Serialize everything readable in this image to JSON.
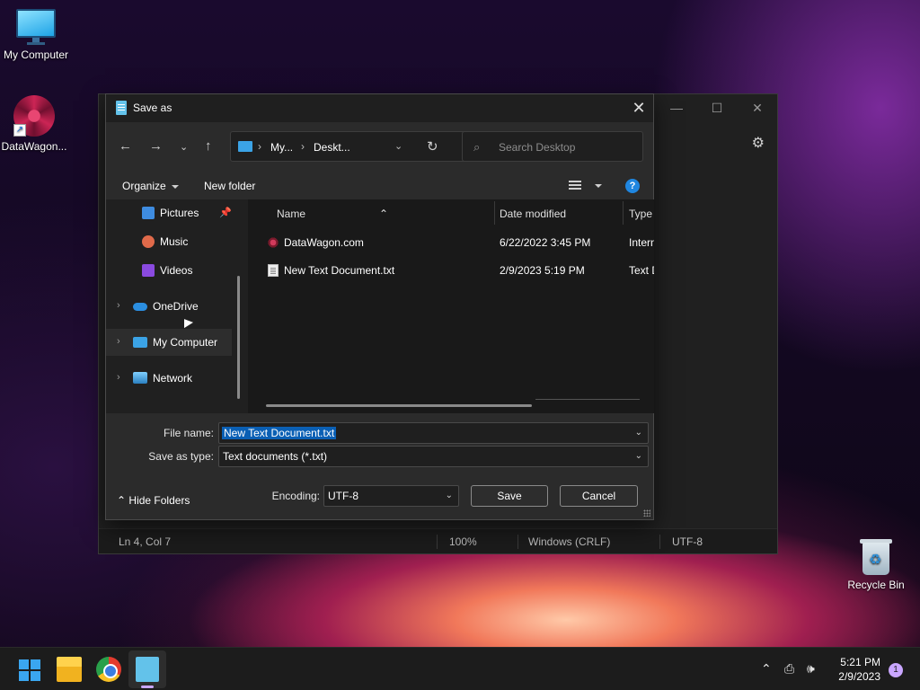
{
  "desktop": {
    "icons": [
      {
        "label": "My Computer",
        "icon": "monitor-icon"
      },
      {
        "label": "DataWagon...",
        "icon": "datawagon-shortcut-icon"
      },
      {
        "label": "Recycle Bin",
        "icon": "recycle-bin-icon"
      }
    ]
  },
  "notepad": {
    "status": {
      "position": "Ln 4, Col 7",
      "zoom": "100%",
      "line_endings": "Windows (CRLF)",
      "encoding": "UTF-8"
    }
  },
  "dialog": {
    "title": "Save as",
    "address": {
      "crumb1": "My...",
      "crumb2": "Deskt..."
    },
    "search_placeholder": "Search Desktop",
    "toolbar": {
      "organize": "Organize",
      "new_folder": "New folder"
    },
    "nav_pane": [
      {
        "label": "Pictures",
        "icon": "pictures-icon"
      },
      {
        "label": "Music",
        "icon": "music-icon"
      },
      {
        "label": "Videos",
        "icon": "videos-icon"
      },
      {
        "label": "OneDrive",
        "icon": "onedrive-icon"
      },
      {
        "label": "My Computer",
        "icon": "computer-icon"
      },
      {
        "label": "Network",
        "icon": "network-icon"
      }
    ],
    "columns": {
      "name": "Name",
      "date": "Date modified",
      "type": "Type"
    },
    "files": [
      {
        "name": "DataWagon.com",
        "date": "6/22/2022 3:45 PM",
        "type": "Intern"
      },
      {
        "name": "New Text Document.txt",
        "date": "2/9/2023 5:19 PM",
        "type": "Text D"
      }
    ],
    "file_name_label": "File name:",
    "file_name_value": "New Text Document.txt",
    "save_type_label": "Save as type:",
    "save_type_value": "Text documents (*.txt)",
    "hide_folders": "Hide Folders",
    "encoding_label": "Encoding:",
    "encoding_value": "UTF-8",
    "save_button": "Save",
    "cancel_button": "Cancel"
  },
  "taskbar": {
    "time": "5:21 PM",
    "date": "2/9/2023",
    "notifications": "1"
  }
}
